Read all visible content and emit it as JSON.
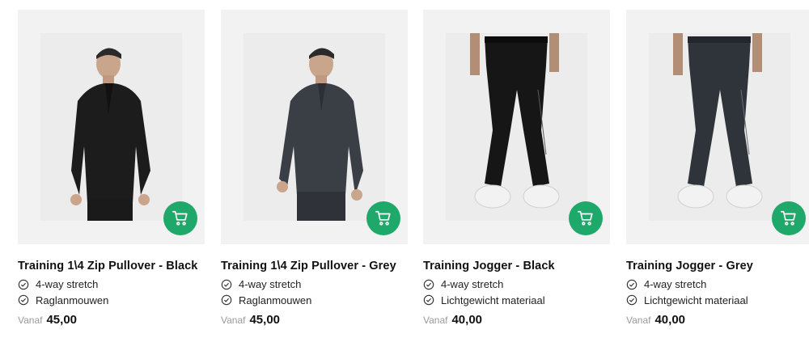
{
  "products": [
    {
      "title": "Training 1\\4 Zip Pullover - Black",
      "features": [
        "4-way stretch",
        "Raglanmouwen"
      ],
      "price_prefix": "Vanaf",
      "price": "45,00",
      "garment_color": "#1c1c1c",
      "garment": "pullover"
    },
    {
      "title": "Training 1\\4 Zip Pullover - Grey",
      "features": [
        "4-way stretch",
        "Raglanmouwen"
      ],
      "price_prefix": "Vanaf",
      "price": "45,00",
      "garment_color": "#3a3f46",
      "garment": "pullover"
    },
    {
      "title": "Training Jogger - Black",
      "features": [
        "4-way stretch",
        "Lichtgewicht materiaal"
      ],
      "price_prefix": "Vanaf",
      "price": "40,00",
      "garment_color": "#161616",
      "garment": "jogger"
    },
    {
      "title": "Training Jogger - Grey",
      "features": [
        "4-way stretch",
        "Lichtgewicht materiaal"
      ],
      "price_prefix": "Vanaf",
      "price": "40,00",
      "garment_color": "#2f343b",
      "garment": "jogger"
    }
  ],
  "icons": {
    "cart": "shopping-cart-icon",
    "check": "check-circle-icon"
  },
  "colors": {
    "cart_button": "#1ea86a",
    "card_background": "#f2f2f2"
  }
}
